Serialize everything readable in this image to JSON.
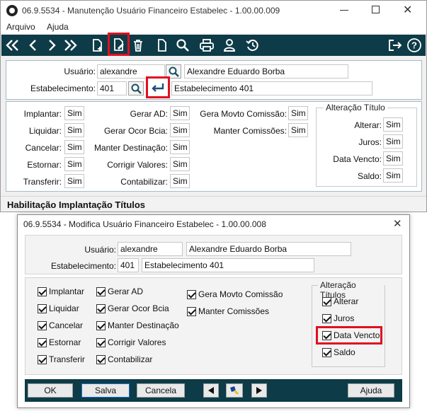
{
  "win1": {
    "title": "06.9.5534 - Manutenção Usuário Financeiro Estabelec - 1.00.00.009",
    "menu": [
      "Arquivo",
      "Ajuda"
    ],
    "usuario_label": "Usuário:",
    "usuario_value": "alexandre",
    "usuario_name": "Alexandre Eduardo Borba",
    "estab_label": "Estabelecimento:",
    "estab_value": "401",
    "estab_name": "Estabelecimento 401",
    "col1": [
      {
        "label": "Implantar:",
        "value": "Sim"
      },
      {
        "label": "Liquidar:",
        "value": "Sim"
      },
      {
        "label": "Cancelar:",
        "value": "Sim"
      },
      {
        "label": "Estornar:",
        "value": "Sim"
      },
      {
        "label": "Transferir:",
        "value": "Sim"
      }
    ],
    "col2": [
      {
        "label": "Gerar AD:",
        "value": "Sim"
      },
      {
        "label": "Gerar Ocor Bcia:",
        "value": "Sim"
      },
      {
        "label": "Manter Destinação:",
        "value": "Sim"
      },
      {
        "label": "Corrigir Valores:",
        "value": "Sim"
      },
      {
        "label": "Contabilizar:",
        "value": "Sim"
      }
    ],
    "col3": [
      {
        "label": "Gera Movto Comissão:",
        "value": "Sim"
      },
      {
        "label": "Manter Comissões:",
        "value": "Sim"
      }
    ],
    "alt_title": "Alteração Título",
    "alt": [
      {
        "label": "Alterar:",
        "value": "Sim"
      },
      {
        "label": "Juros:",
        "value": "Sim"
      },
      {
        "label": "Data Vencto:",
        "value": "Sim"
      },
      {
        "label": "Saldo:",
        "value": "Sim"
      }
    ],
    "section_title": "Habilitação Implantação Títulos"
  },
  "win2": {
    "title": "06.9.5534 - Modifica Usuário Financeiro Estabelec - 1.00.00.008",
    "usuario_label": "Usuário:",
    "usuario_value": "alexandre",
    "usuario_name": "Alexandre Eduardo Borba",
    "estab_label": "Estabelecimento:",
    "estab_value": "401",
    "estab_name": "Estabelecimento 401",
    "col1": [
      "Implantar",
      "Liquidar",
      "Cancelar",
      "Estornar",
      "Transferir"
    ],
    "col2": [
      "Gerar AD",
      "Gerar Ocor Bcia",
      "Manter Destinação",
      "Corrigir Valores",
      "Contabilizar"
    ],
    "col3": [
      "Gera Movto Comissão",
      "Manter Comissões"
    ],
    "alt_title": "Alteração Títulos",
    "alt": [
      "Alterar",
      "Juros",
      "Data Vencto",
      "Saldo"
    ],
    "buttons": {
      "ok": "OK",
      "salva": "Salva",
      "cancela": "Cancela",
      "ajuda": "Ajuda"
    }
  },
  "colors": {
    "toolbar": "#0d3b47",
    "highlight": "#e0101f"
  }
}
